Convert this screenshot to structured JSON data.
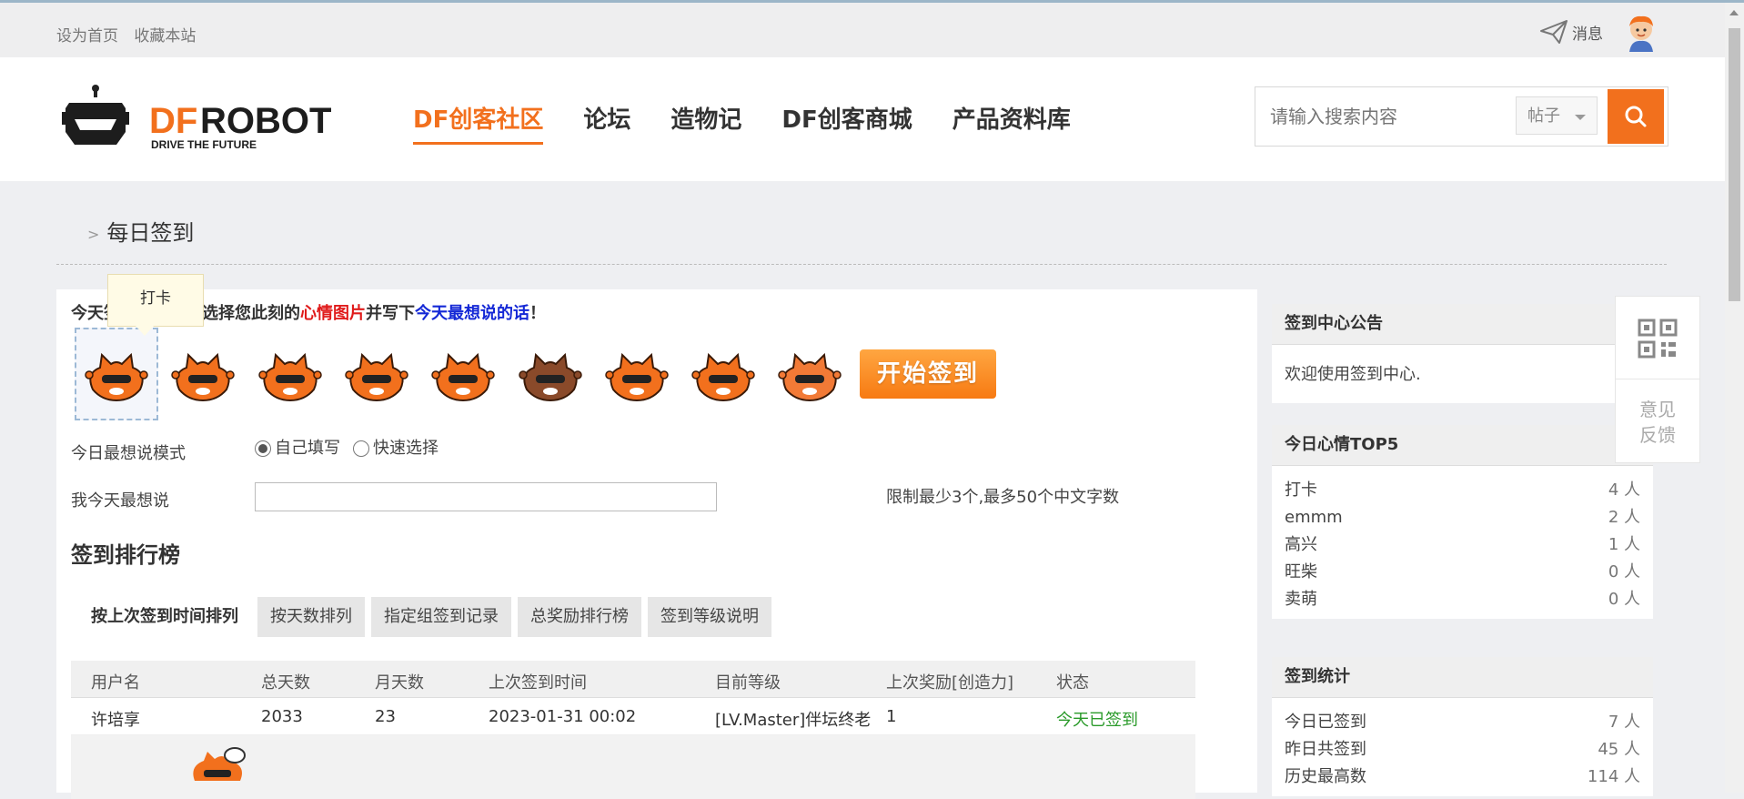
{
  "topbar": {
    "set_home": "设为首页",
    "bookmark": "收藏本站",
    "messages": "消息"
  },
  "logo": {
    "brand_df": "DF",
    "brand_robot": "ROBOT",
    "tagline": "DRIVE THE FUTURE"
  },
  "nav": [
    {
      "label": "DF创客社区",
      "active": true
    },
    {
      "label": "论坛"
    },
    {
      "label": "造物记"
    },
    {
      "label": "DF创客商城"
    },
    {
      "label": "产品资料库"
    }
  ],
  "search": {
    "placeholder": "请输入搜索内容",
    "type": "帖子"
  },
  "breadcrumb": {
    "current": "每日签到"
  },
  "checkin": {
    "intro_a": "今天签到了吗？请选择您此刻的",
    "intro_mood": "心情图片",
    "intro_b": "并写下",
    "intro_words": "今天最想说的话",
    "intro_end": "！",
    "tooltip": "打卡",
    "start_button": "开始签到",
    "mode_label": "今日最想说模式",
    "mode_options": [
      "自己填写",
      "快速选择"
    ],
    "say_label": "我今天最想说",
    "hint": "限制最少3个,最多50个中文字数"
  },
  "ranking": {
    "title": "签到排行榜",
    "tabs": [
      "按上次签到时间排列",
      "按天数排列",
      "指定组签到记录",
      "总奖励排行榜",
      "签到等级说明"
    ],
    "columns": [
      "用户名",
      "总天数",
      "月天数",
      "上次签到时间",
      "目前等级",
      "上次奖励[创造力]",
      "状态"
    ],
    "rows": [
      {
        "user": "许培享",
        "total": "2033",
        "month": "23",
        "last": "2023-01-31 00:02",
        "level": "[LV.Master]伴坛终老",
        "reward": "1",
        "status": "今天已签到"
      }
    ]
  },
  "sidebar": {
    "notice": {
      "title": "签到中心公告",
      "text": "欢迎使用签到中心."
    },
    "mood_top": {
      "title": "今日心情TOP5",
      "items": [
        {
          "name": "打卡",
          "count": "4 人"
        },
        {
          "name": "emmm",
          "count": "2 人"
        },
        {
          "name": "高兴",
          "count": "1 人"
        },
        {
          "name": "旺柴",
          "count": "0 人"
        },
        {
          "name": "卖萌",
          "count": "0 人"
        }
      ]
    },
    "stats": {
      "title": "签到统计",
      "items": [
        {
          "name": "今日已签到",
          "count": "7 人"
        },
        {
          "name": "昨日共签到",
          "count": "45 人"
        },
        {
          "name": "历史最高数",
          "count": "114 人"
        }
      ]
    }
  },
  "float": {
    "feedback": "意见反馈"
  },
  "colors": {
    "accent": "#f2701d",
    "mood_red": "#e01b1b",
    "words_blue": "#1428d6",
    "status_green": "#2a9a2a"
  }
}
